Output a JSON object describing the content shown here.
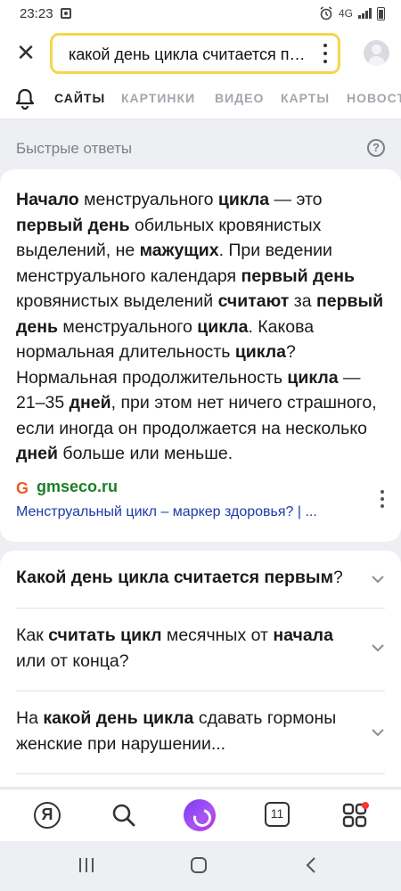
{
  "status_bar": {
    "time": "23:23",
    "network": "4G"
  },
  "search": {
    "query": "какой день цикла считается первым"
  },
  "tabs": [
    {
      "label": "САЙТЫ",
      "active": true
    },
    {
      "label": "КАРТИНКИ",
      "active": false
    },
    {
      "label": "ВИДЕО",
      "active": false
    },
    {
      "label": "КАРТЫ",
      "active": false
    },
    {
      "label": "НОВОСТИ",
      "active": false
    }
  ],
  "quick_answers": {
    "title": "Быстрые ответы",
    "help": "?"
  },
  "answer": {
    "segments": [
      {
        "t": "Начало",
        "b": true
      },
      {
        "t": " менструального ",
        "b": false
      },
      {
        "t": "цикла",
        "b": true
      },
      {
        "t": " — это ",
        "b": false
      },
      {
        "t": "первый день",
        "b": true
      },
      {
        "t": " обильных кровянистых выделений, не ",
        "b": false
      },
      {
        "t": "мажущих",
        "b": true
      },
      {
        "t": ". При ведении менструального календаря ",
        "b": false
      },
      {
        "t": "первый день",
        "b": true
      },
      {
        "t": " кровянистых выделений ",
        "b": false
      },
      {
        "t": "считают",
        "b": true
      },
      {
        "t": " за ",
        "b": false
      },
      {
        "t": "первый день",
        "b": true
      },
      {
        "t": " менструального ",
        "b": false
      },
      {
        "t": "цикла",
        "b": true
      },
      {
        "t": ". Какова нормальная длительность ",
        "b": false
      },
      {
        "t": "цикла",
        "b": true
      },
      {
        "t": "? Нормальная продолжительность ",
        "b": false
      },
      {
        "t": "цикла",
        "b": true
      },
      {
        "t": " — 21–35 ",
        "b": false
      },
      {
        "t": "дней",
        "b": true
      },
      {
        "t": ", при этом нет ничего страшного, если иногда он продолжается на несколько ",
        "b": false
      },
      {
        "t": "дней",
        "b": true
      },
      {
        "t": " больше или меньше.",
        "b": false
      }
    ],
    "source_domain": "gmseco.ru",
    "source_title": "Менструальный цикл – маркер здоровья? | ..."
  },
  "faq": [
    {
      "segments": [
        {
          "t": "Какой день цикла считается первым",
          "b": true
        },
        {
          "t": "?",
          "b": false
        }
      ]
    },
    {
      "segments": [
        {
          "t": "Как ",
          "b": false
        },
        {
          "t": "считать цикл",
          "b": true
        },
        {
          "t": " месячных от ",
          "b": false
        },
        {
          "t": "начала",
          "b": true
        },
        {
          "t": " или от конца?",
          "b": false
        }
      ]
    },
    {
      "segments": [
        {
          "t": "На ",
          "b": false
        },
        {
          "t": "какой день цикла",
          "b": true
        },
        {
          "t": " сдавать гормоны женские при нарушении...",
          "b": false
        }
      ]
    }
  ],
  "bottom_nav": {
    "yandex_label": "Я",
    "tabs_count": "11"
  },
  "colors": {
    "search_border": "#f6d64a",
    "source_green": "#1b7f28",
    "link_blue": "#1c3aa8",
    "alice_purple": "#8b3ff0"
  }
}
